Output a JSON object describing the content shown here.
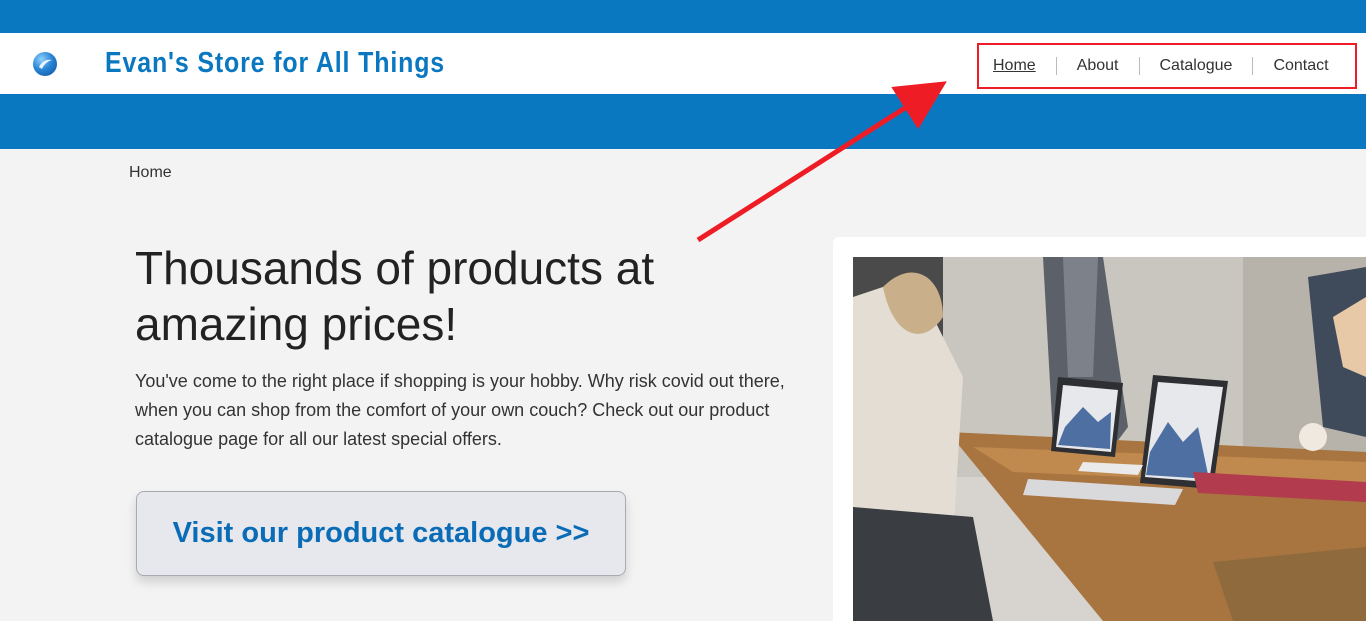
{
  "header": {
    "logo_icon": "globe-swirl-icon",
    "site_title": "Evan's Store for All Things",
    "brand_color": "#0a78c0"
  },
  "nav": {
    "items": [
      {
        "label": "Home",
        "active": true
      },
      {
        "label": "About",
        "active": false
      },
      {
        "label": "Catalogue",
        "active": false
      },
      {
        "label": "Contact",
        "active": false
      }
    ],
    "highlight_color": "#ee1c24"
  },
  "breadcrumb": "Home",
  "hero": {
    "headline": "Thousands of products at amazing prices!",
    "intro": "You've come to the right place if shopping is your hobby. Why risk covid out there, when you can shop from the comfort of your own couch? Check out our product catalogue page for all our latest special offers.",
    "cta_label": "Visit our product catalogue >>"
  },
  "annotation": {
    "arrow_color": "#ee1c24"
  }
}
